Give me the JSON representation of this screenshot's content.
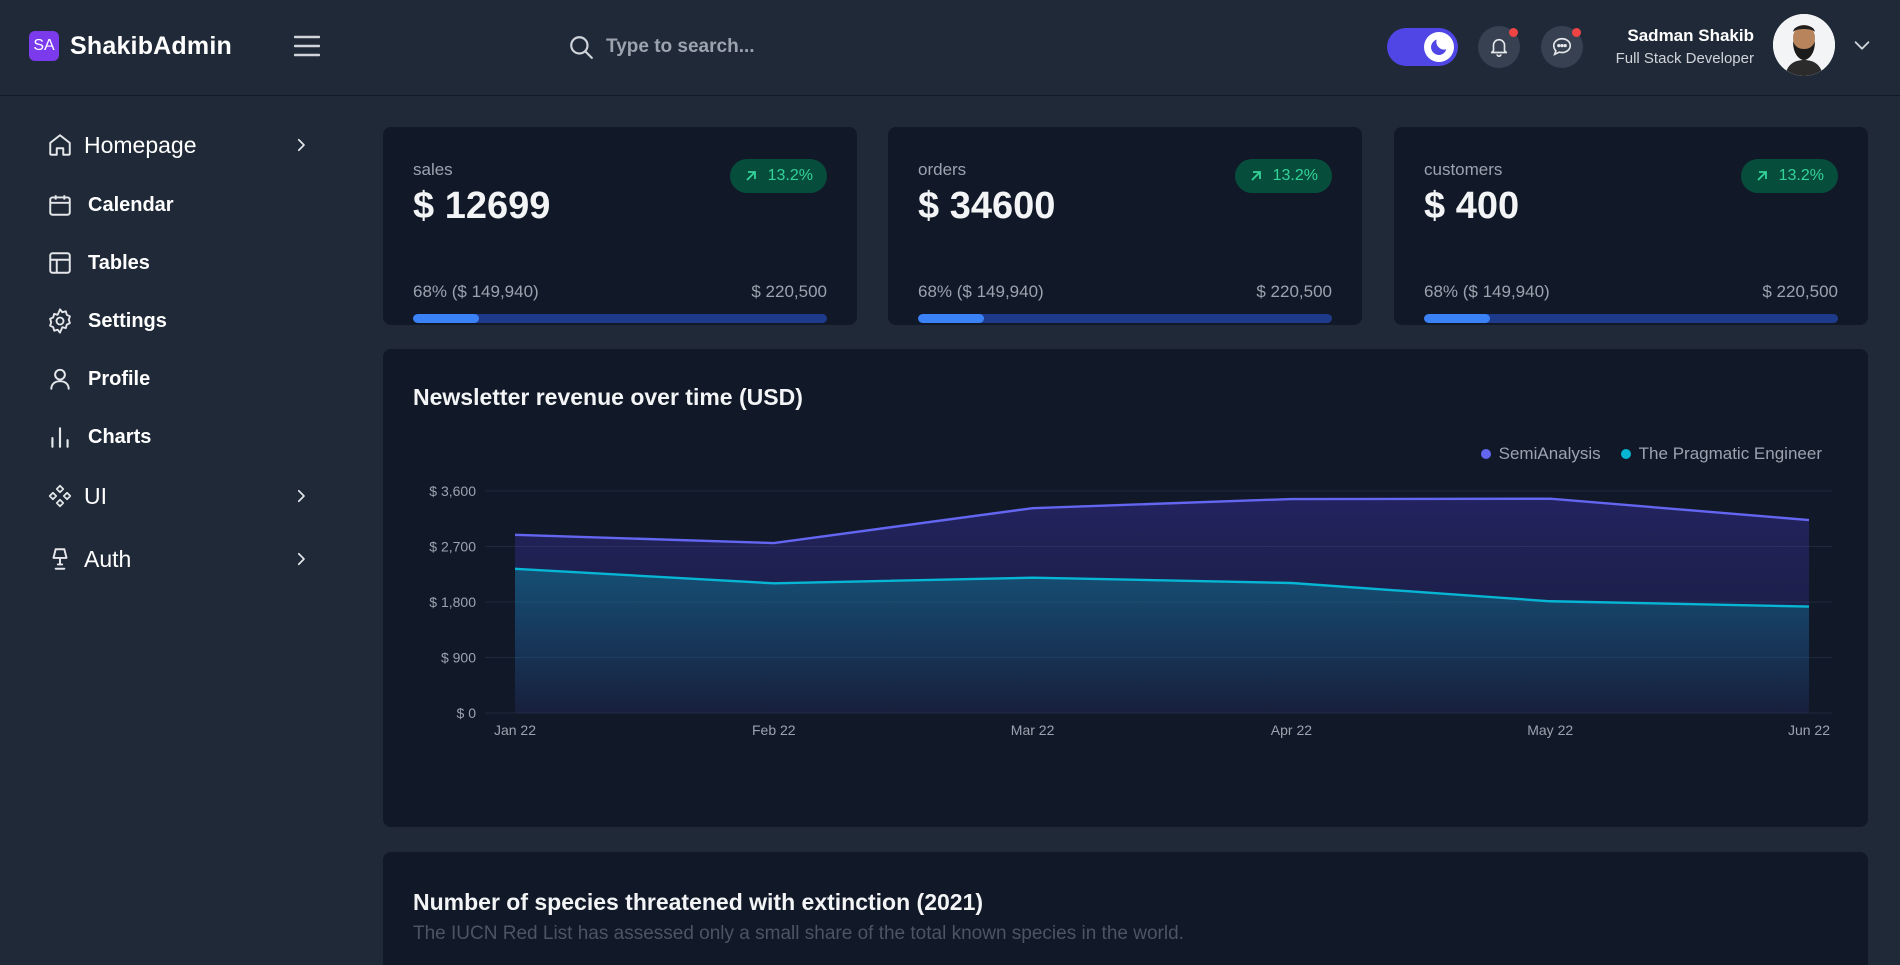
{
  "brand": {
    "badge": "SA",
    "name": "ShakibAdmin"
  },
  "search": {
    "placeholder": "Type to search..."
  },
  "user": {
    "name": "Sadman Shakib",
    "role": "Full Stack Developer"
  },
  "sidebar": {
    "items": [
      {
        "label": "Homepage",
        "icon": "home-icon",
        "has_children": true
      },
      {
        "label": "Calendar",
        "icon": "calendar-icon",
        "has_children": false
      },
      {
        "label": "Tables",
        "icon": "table-icon",
        "has_children": false
      },
      {
        "label": "Settings",
        "icon": "gear-icon",
        "has_children": false
      },
      {
        "label": "Profile",
        "icon": "user-icon",
        "has_children": false
      },
      {
        "label": "Charts",
        "icon": "bar-chart-icon",
        "has_children": false
      },
      {
        "label": "UI",
        "icon": "components-icon",
        "has_children": true
      },
      {
        "label": "Auth",
        "icon": "lamp-icon",
        "has_children": true
      }
    ]
  },
  "stats": [
    {
      "label": "sales",
      "value": "$ 12699",
      "badge": "13.2%",
      "sub_left": "68% ($ 149,940)",
      "sub_right": "$ 220,500",
      "progress": 0.16
    },
    {
      "label": "orders",
      "value": "$ 34600",
      "badge": "13.2%",
      "sub_left": "68% ($ 149,940)",
      "sub_right": "$ 220,500",
      "progress": 0.16
    },
    {
      "label": "customers",
      "value": "$ 400",
      "badge": "13.2%",
      "sub_left": "68% ($ 149,940)",
      "sub_right": "$ 220,500",
      "progress": 0.16
    }
  ],
  "chart": {
    "title": "Newsletter revenue over time (USD)"
  },
  "chart_data": {
    "type": "area",
    "title": "Newsletter revenue over time (USD)",
    "categories": [
      "Jan 22",
      "Feb 22",
      "Mar 22",
      "Apr 22",
      "May 22",
      "Jun 22"
    ],
    "y_ticks": [
      "$ 0",
      "$ 900",
      "$ 1,800",
      "$ 2,700",
      "$ 3,600"
    ],
    "ylim": [
      0,
      3600
    ],
    "grid": true,
    "legend_position": "top-right",
    "series": [
      {
        "name": "SemiAnalysis",
        "color": "#6366f1",
        "values": [
          2890,
          2756,
          3322,
          3470,
          3475,
          3129
        ]
      },
      {
        "name": "The Pragmatic Engineer",
        "color": "#06b6d4",
        "values": [
          2338,
          2103,
          2194,
          2108,
          1812,
          1726
        ]
      }
    ]
  },
  "species": {
    "title": "Number of species threatened with extinction (2021)",
    "subtitle": "The IUCN Red List has assessed only a small share of the total known species in the world."
  },
  "colors": {
    "accent": "#7c3aed",
    "toggle": "#4f46e5",
    "positive": "#34d399",
    "progress": "#3b82f6"
  }
}
